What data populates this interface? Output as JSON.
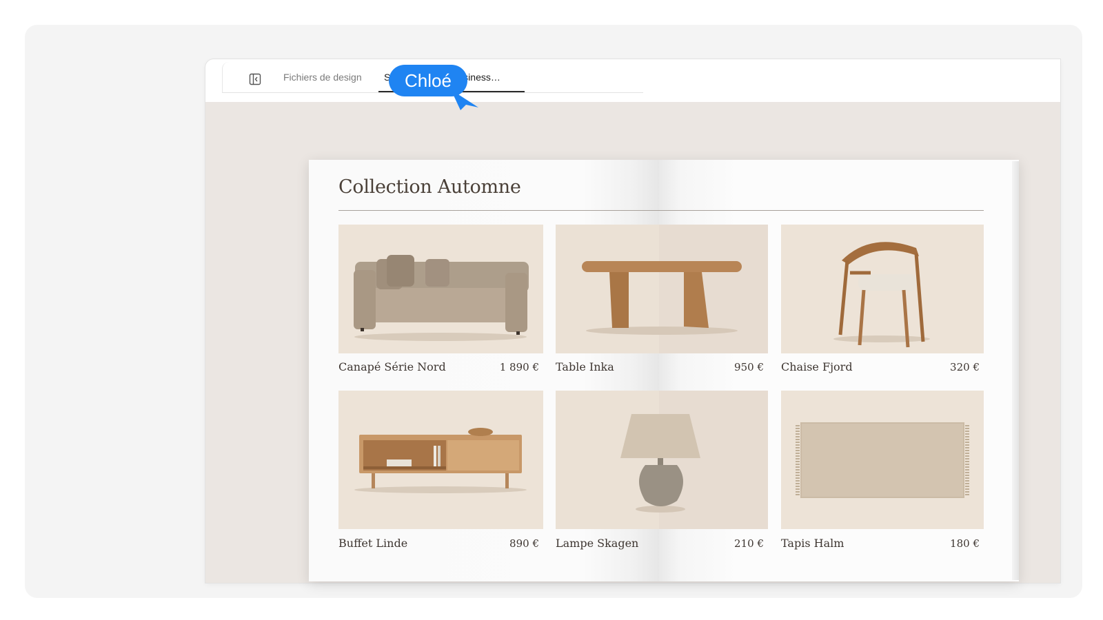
{
  "tabs": {
    "sidebar_toggle": "panel-left-icon",
    "design_files": "Fichiers de design",
    "active": "Studio Lumière Business…"
  },
  "catalog": {
    "title": "Collection Automne",
    "items": [
      {
        "name": "Canapé Série Nord",
        "price": "1 890 €",
        "icon": "sofa-image"
      },
      {
        "name": "Table Inka",
        "price": "950 €",
        "icon": "table-image"
      },
      {
        "name": "Chaise Fjord",
        "price": "320 €",
        "icon": "chair-image"
      },
      {
        "name": "Buffet Linde",
        "price": "890 €",
        "icon": "sideboard-image"
      },
      {
        "name": "Lampe Skagen",
        "price": "210 €",
        "icon": "lamp-image"
      },
      {
        "name": "Tapis Halm",
        "price": "180 €",
        "icon": "rug-image"
      }
    ]
  },
  "collaborator": {
    "name": "Chloé",
    "color": "#1f84f2"
  }
}
